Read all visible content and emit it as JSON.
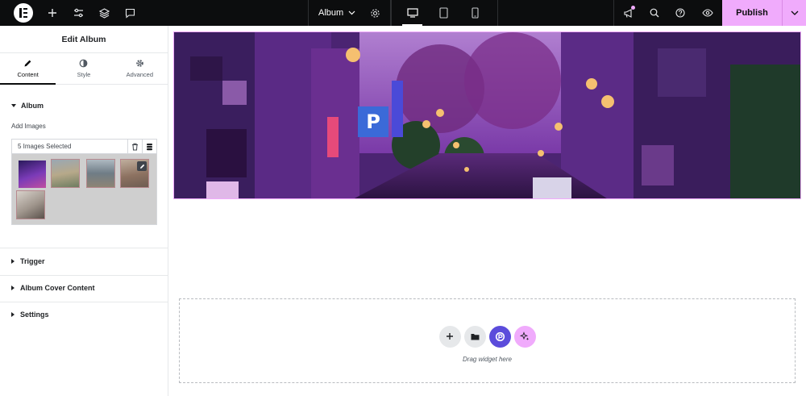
{
  "topbar": {
    "document_title": "Album",
    "publish_label": "Publish",
    "devices": [
      "desktop",
      "tablet",
      "mobile"
    ],
    "active_device": "desktop",
    "accent_color": "#f0abfc"
  },
  "panel": {
    "header_title": "Edit Album",
    "tabs": [
      {
        "label": "Content",
        "icon": "pencil-icon",
        "active": true
      },
      {
        "label": "Style",
        "icon": "contrast-icon",
        "active": false
      },
      {
        "label": "Advanced",
        "icon": "gear-icon",
        "active": false
      }
    ],
    "album_section": {
      "title": "Album",
      "add_images_label": "Add Images",
      "gallery_count_text": "5 Images Selected",
      "thumbnail_count": 5
    },
    "sections": [
      {
        "title": "Trigger"
      },
      {
        "title": "Album Cover Content"
      },
      {
        "title": "Settings"
      }
    ]
  },
  "canvas": {
    "drop_text": "Drag widget here"
  }
}
